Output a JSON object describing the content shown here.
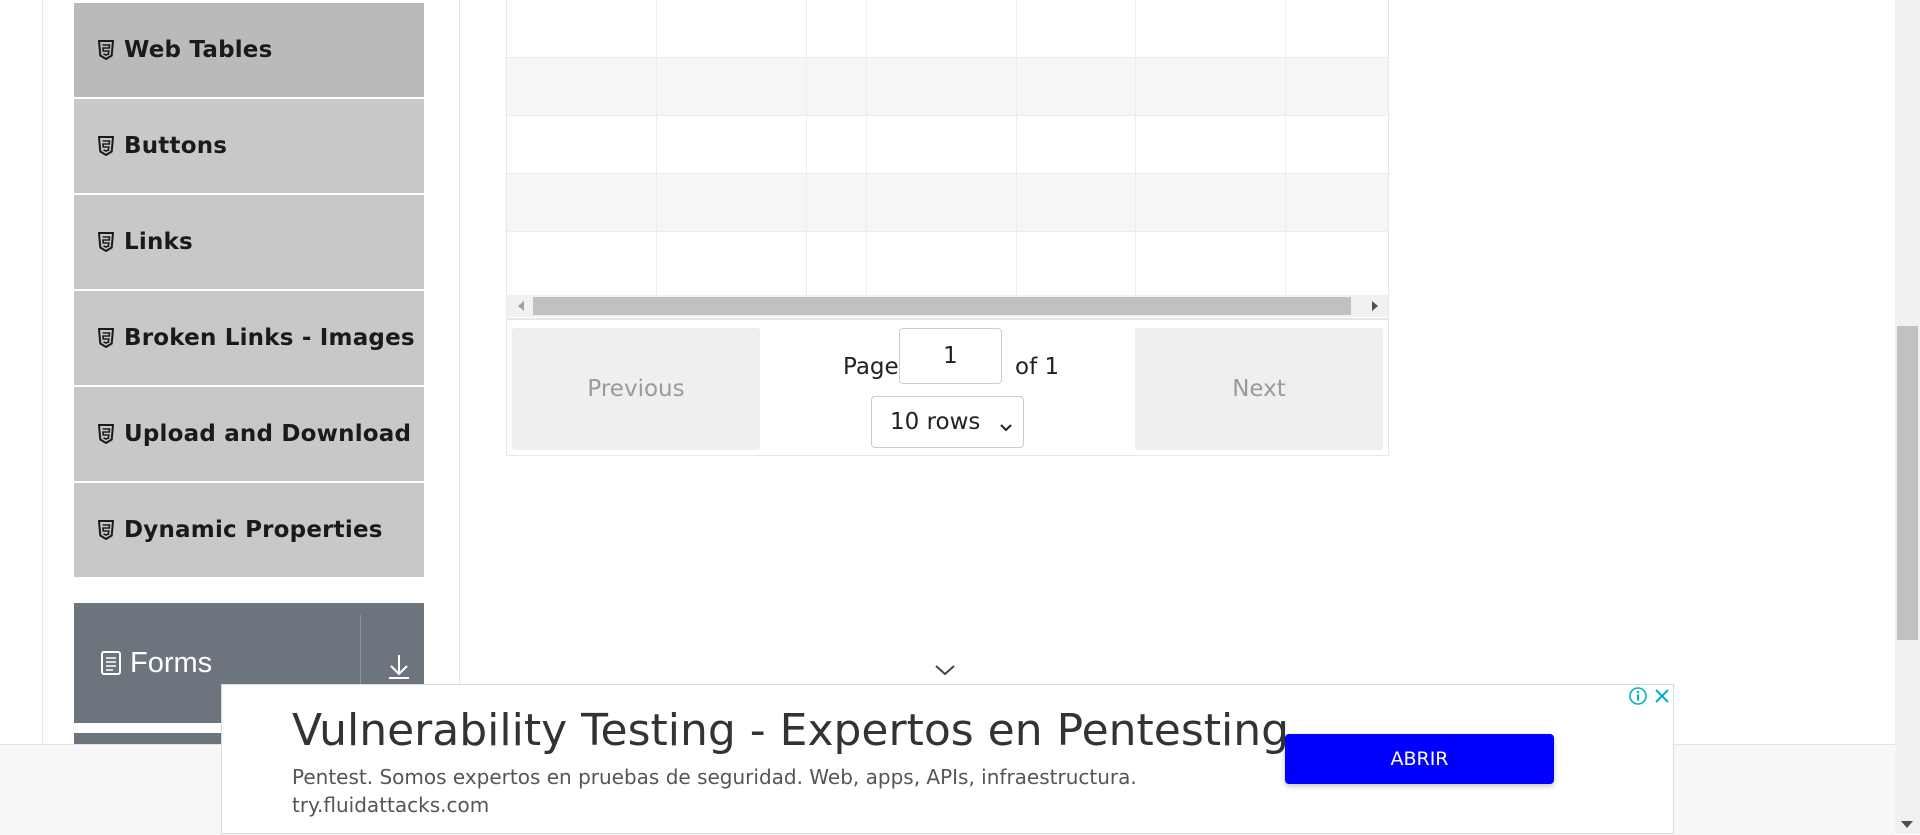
{
  "sidebar": {
    "items": [
      {
        "label": "Web Tables",
        "icon": "html5-icon",
        "active": true
      },
      {
        "label": "Buttons",
        "icon": "html5-icon"
      },
      {
        "label": "Links",
        "icon": "html5-icon"
      },
      {
        "label": "Broken Links - Images",
        "icon": "html5-icon"
      },
      {
        "label": "Upload and Download",
        "icon": "html5-icon"
      },
      {
        "label": "Dynamic Properties",
        "icon": "html5-icon"
      }
    ],
    "group": {
      "label": "Forms",
      "icon": "document-icon",
      "toggle_icon": "download-arrow-icon"
    }
  },
  "pagination": {
    "previous_label": "Previous",
    "next_label": "Next",
    "page_label": "Page",
    "page_value": "1",
    "of_label": "of 1",
    "rows_selected": "10 rows"
  },
  "ad": {
    "title": "Vulnerability Testing - Expertos en Pentesting",
    "description": "Pentest. Somos expertos en pruebas de seguridad. Web, apps, APIs, infraestructura.",
    "url": "try.fluidattacks.com",
    "cta_label": "ABRIR"
  },
  "colors": {
    "sidebar_item_bg": "#c8c8c8",
    "sidebar_active_bg": "#bababa",
    "group_bg": "#6c757d",
    "ad_cta_bg": "#0000ff"
  }
}
